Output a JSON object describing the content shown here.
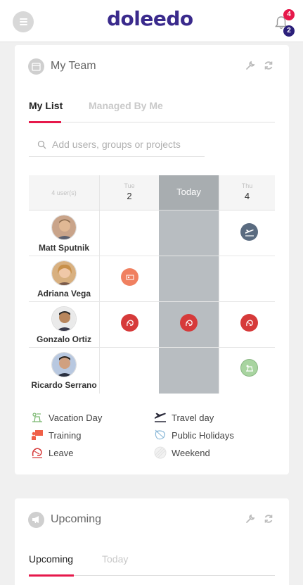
{
  "header": {
    "logo": "doleedo",
    "notifications_count": "4",
    "messages_count": "2"
  },
  "team_card": {
    "title": "My Team",
    "tabs": [
      {
        "label": "My List",
        "active": true
      },
      {
        "label": "Managed By Me",
        "active": false
      }
    ],
    "search_placeholder": "Add users, groups or projects",
    "grid": {
      "user_count": "4 user(s)",
      "columns": [
        {
          "day": "Tue",
          "date": "2"
        },
        {
          "label": "Today"
        },
        {
          "day": "Thu",
          "date": "4"
        }
      ],
      "rows": [
        {
          "name": "Matt Sputnik",
          "events": [
            null,
            null,
            "travel"
          ]
        },
        {
          "name": "Adriana Vega",
          "events": [
            "training",
            null,
            null
          ]
        },
        {
          "name": "Gonzalo Ortiz",
          "events": [
            "leave",
            "leave",
            "leave"
          ]
        },
        {
          "name": "Ricardo Serrano",
          "events": [
            null,
            null,
            "vacation"
          ]
        }
      ]
    },
    "legend": [
      {
        "label": "Vacation Day",
        "icon": "vacation-icon"
      },
      {
        "label": "Travel day",
        "icon": "plane-icon"
      },
      {
        "label": "Training",
        "icon": "training-icon"
      },
      {
        "label": "Public Holidays",
        "icon": "holiday-icon"
      },
      {
        "label": "Leave",
        "icon": "leave-icon"
      },
      {
        "label": "Weekend",
        "icon": "weekend-icon"
      }
    ]
  },
  "upcoming_card": {
    "title": "Upcoming",
    "tabs": [
      {
        "label": "Upcoming",
        "active": true
      },
      {
        "label": "Today",
        "active": false
      }
    ]
  },
  "colors": {
    "brand": "#3a2a8c",
    "accent": "#e6194b",
    "travel": "#5a6b80",
    "training": "#f08060",
    "leave": "#d63a3a",
    "vacation": "#a8d4a0",
    "today_column": "#b8bdc1"
  }
}
